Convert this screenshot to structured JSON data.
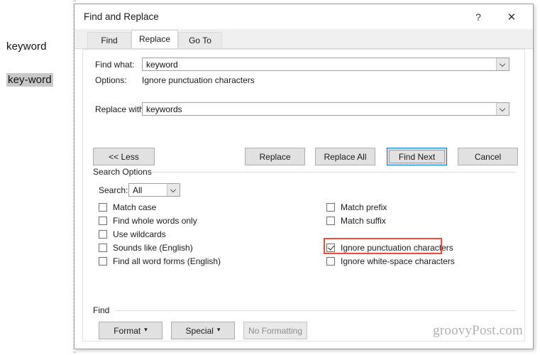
{
  "document": {
    "line1": "keyword",
    "line2": "key-word"
  },
  "dialog": {
    "title": "Find and Replace",
    "help_icon": "?",
    "close_icon": "✕",
    "tabs": [
      {
        "label": "Find",
        "active": false
      },
      {
        "label": "Replace",
        "active": true
      },
      {
        "label": "Go To",
        "active": false
      }
    ],
    "find_what_label": "Find what:",
    "find_what_value": "keyword",
    "options_label": "Options:",
    "options_value": "Ignore punctuation characters",
    "replace_with_label": "Replace with:",
    "replace_with_value": "keywords",
    "buttons": {
      "less": "<< Less",
      "replace": "Replace",
      "replace_all": "Replace All",
      "find_next": "Find Next",
      "cancel": "Cancel"
    },
    "search_options": {
      "group_title": "Search Options",
      "search_label": "Search:",
      "search_value": "All",
      "left_checkboxes": [
        {
          "label": "Match case",
          "checked": false
        },
        {
          "label": "Find whole words only",
          "checked": false
        },
        {
          "label": "Use wildcards",
          "checked": false
        },
        {
          "label": "Sounds like (English)",
          "checked": false
        },
        {
          "label": "Find all word forms (English)",
          "checked": false
        }
      ],
      "right_checkboxes": [
        {
          "label": "Match prefix",
          "checked": false
        },
        {
          "label": "Match suffix",
          "checked": false
        },
        {
          "label": "Ignore punctuation characters",
          "checked": true,
          "highlighted": true
        },
        {
          "label": "Ignore white-space characters",
          "checked": false
        }
      ]
    },
    "find_section": {
      "group_title": "Find",
      "format_button": "Format",
      "special_button": "Special",
      "no_formatting_button": "No Formatting",
      "dropdown_caret": "▾"
    }
  },
  "watermark": "groovyPost.com",
  "colors": {
    "focus_blue": "#0078d7",
    "highlight_red": "#ef4a3a",
    "selection_gray": "#c8c8c8"
  }
}
